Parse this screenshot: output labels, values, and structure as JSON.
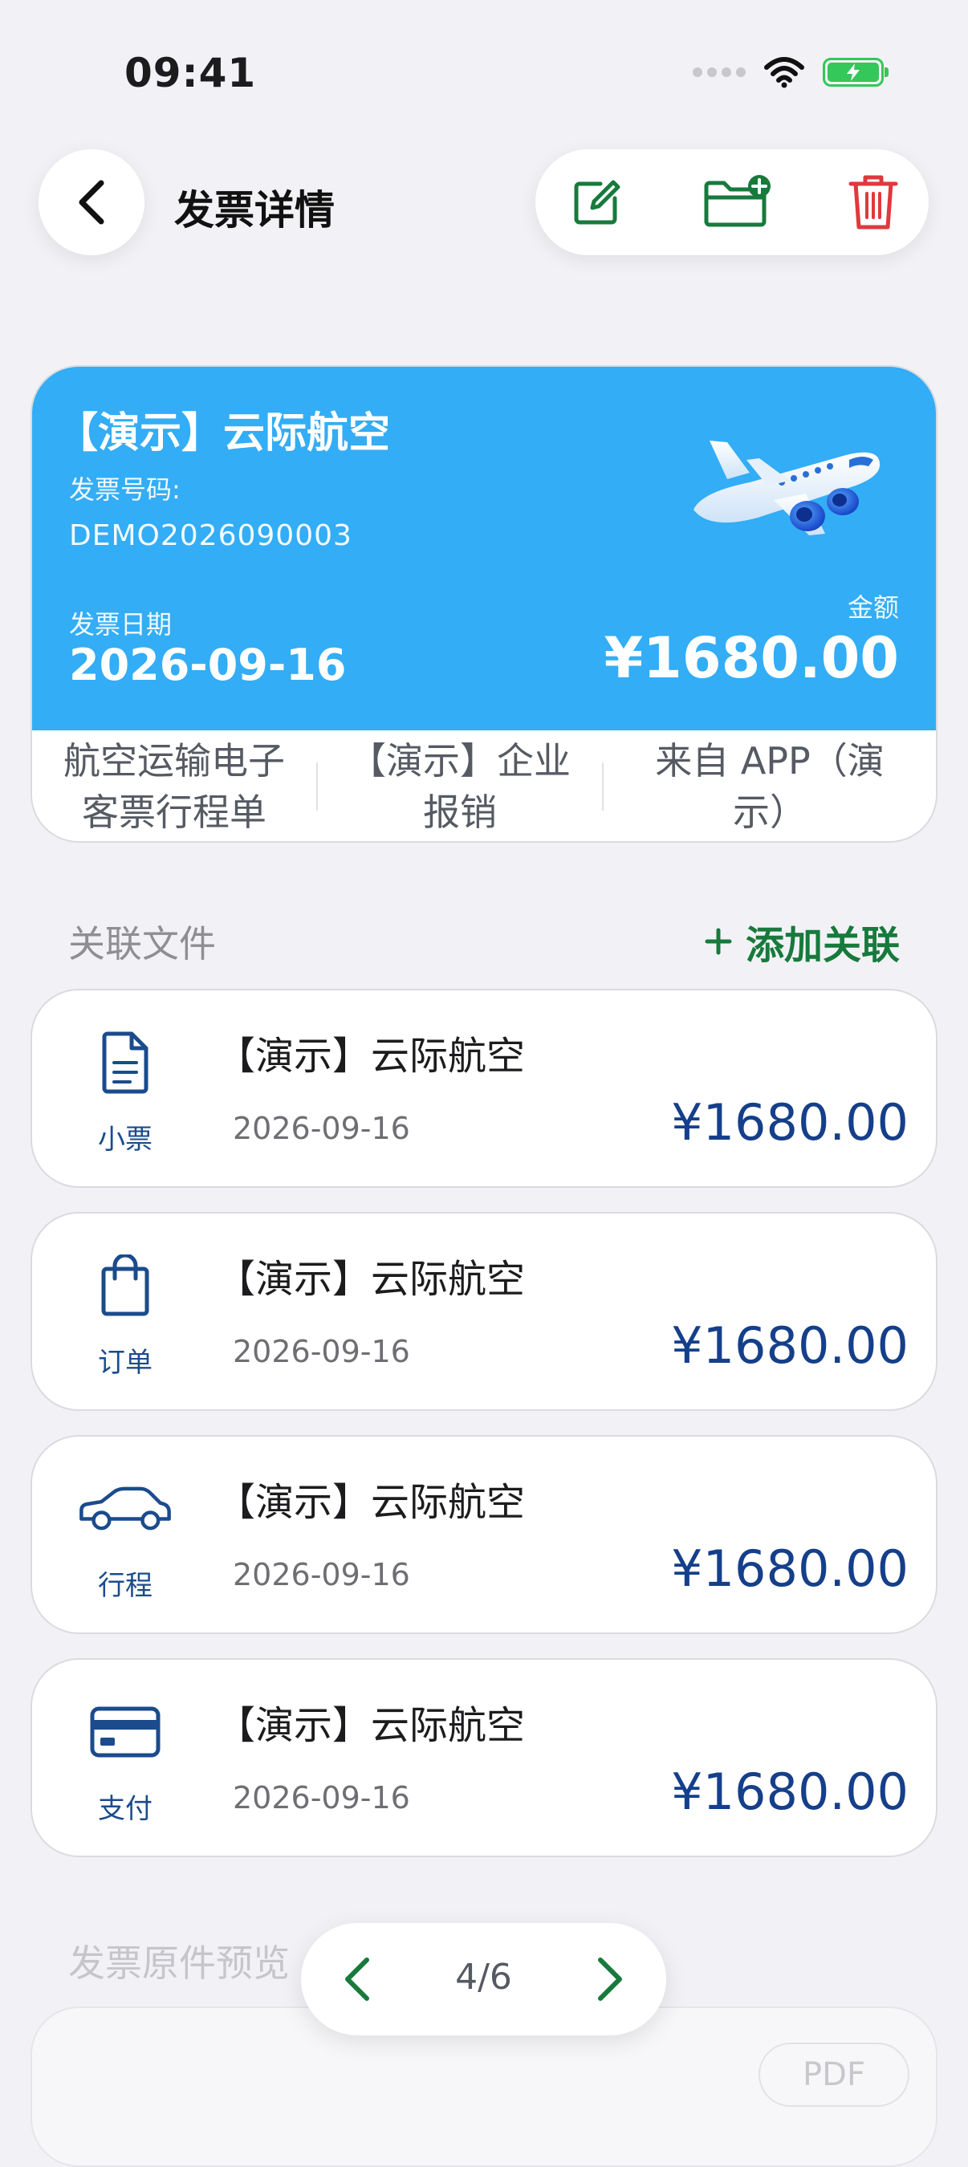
{
  "status_bar": {
    "time": "09:41"
  },
  "nav": {
    "title": "发票详情"
  },
  "invoice": {
    "seller": "【演示】云际航空",
    "number_label": "发票号码:",
    "number": "DEMO2026090003",
    "date_label": "发票日期",
    "date": "2026-09-16",
    "amount_label": "金额",
    "amount": "¥1680.00",
    "tags": [
      "航空运输电子客票行程单",
      "【演示】企业报销",
      "来自 APP（演示）"
    ],
    "accent_color": "#33adf5"
  },
  "related": {
    "title": "关联文件",
    "add_label": "添加关联",
    "items": [
      {
        "icon": "document-icon",
        "label": "小票",
        "name": "【演示】云际航空",
        "date": "2026-09-16",
        "amount": "¥1680.00"
      },
      {
        "icon": "bag-icon",
        "label": "订单",
        "name": "【演示】云际航空",
        "date": "2026-09-16",
        "amount": "¥1680.00"
      },
      {
        "icon": "car-icon",
        "label": "行程",
        "name": "【演示】云际航空",
        "date": "2026-09-16",
        "amount": "¥1680.00"
      },
      {
        "icon": "card-icon",
        "label": "支付",
        "name": "【演示】云际航空",
        "date": "2026-09-16",
        "amount": "¥1680.00"
      }
    ]
  },
  "preview": {
    "title": "发票原件预览",
    "format_tag": "PDF"
  },
  "pager": {
    "text": "4/6"
  }
}
